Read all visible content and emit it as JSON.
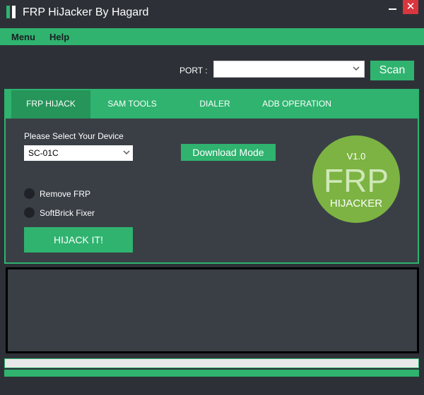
{
  "window": {
    "title": "FRP HiJacker By Hagard",
    "minimize_icon": "minimize-icon",
    "close_label": "✕"
  },
  "menu": {
    "items": [
      {
        "label": "Menu"
      },
      {
        "label": "Help"
      }
    ]
  },
  "port": {
    "label": "PORT :",
    "value": "",
    "scan_label": "Scan"
  },
  "tabs": [
    {
      "label": "FRP HIJACK",
      "active": true
    },
    {
      "label": "SAM TOOLS",
      "active": false
    },
    {
      "label": "DIALER",
      "active": false
    },
    {
      "label": "ADB OPERATION",
      "active": false
    }
  ],
  "frp_hijack": {
    "device_label": "Please Select Your Device",
    "device_value": "SC-01C",
    "download_mode_label": "Download Mode",
    "options": [
      {
        "label": "Remove FRP",
        "checked": false
      },
      {
        "label": "SoftBrick Fixer",
        "checked": false
      }
    ],
    "hijack_label": "HIJACK IT!"
  },
  "logo": {
    "version": "V1.0",
    "main": "FRP",
    "sub": "HIJACKER"
  },
  "output": {
    "text": ""
  },
  "progress": {
    "value": 0
  },
  "colors": {
    "accent": "#2fb36f",
    "background": "#2d3137",
    "panel": "#3a3f46",
    "close": "#d9363e",
    "logo_fill": "#7cb342"
  }
}
